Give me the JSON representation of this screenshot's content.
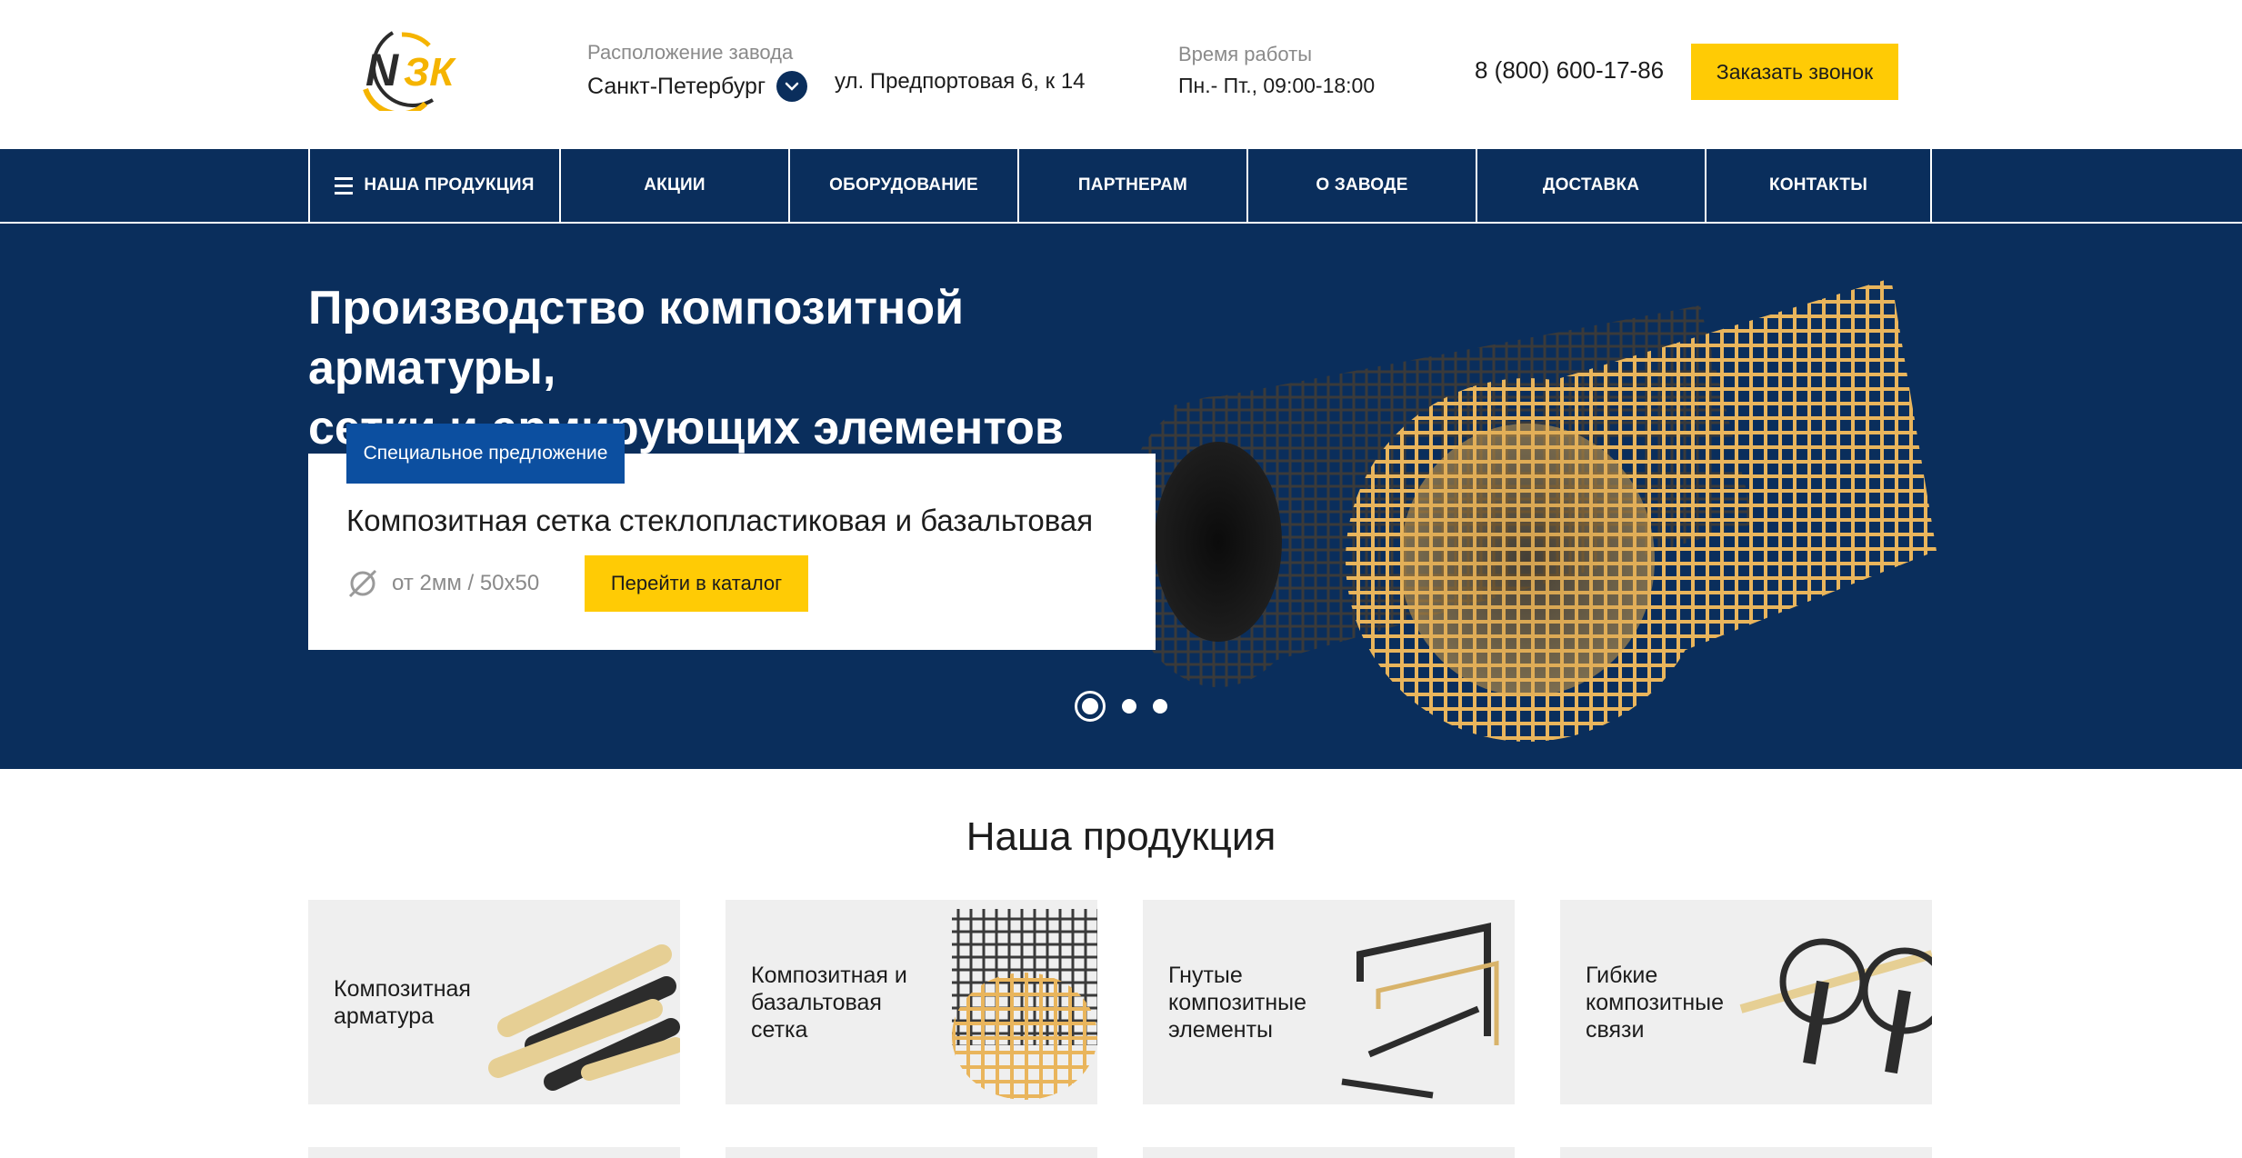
{
  "header": {
    "logo_text": "NЗК",
    "location_caption": "Расположение завода",
    "city": "Санкт-Петербург",
    "address": "ул. Предпортовая 6, к 14",
    "hours_caption": "Время работы",
    "hours": "Пн.- Пт., 09:00-18:00",
    "phone": "8 (800) 600-17-86",
    "call_button": "Заказать звонок"
  },
  "nav": {
    "items": [
      {
        "label": "НАША ПРОДУКЦИЯ"
      },
      {
        "label": "АКЦИИ"
      },
      {
        "label": "ОБОРУДОВАНИЕ"
      },
      {
        "label": "ПАРТНЕРАМ"
      },
      {
        "label": "О ЗАВОДЕ"
      },
      {
        "label": "ДОСТАВКА"
      },
      {
        "label": "КОНТАКТЫ"
      }
    ]
  },
  "hero": {
    "title_line1": "Производство композитной арматуры,",
    "title_line2": "сетки и армирующих элементов",
    "badge": "Специальное предложение",
    "offer_title": "Композитная сетка стеклопластиковая и базальтовая",
    "offer_spec": "от 2мм / 50х50",
    "catalog_button": "Перейти в каталог",
    "slides_total": 3,
    "active_slide": 1
  },
  "products": {
    "title": "Наша продукция",
    "items": [
      {
        "label": "Композитная арматура"
      },
      {
        "label": "Композитная и базальтовая сетка"
      },
      {
        "label": "Гнутые композитные элементы"
      },
      {
        "label": "Гибкие композитные связи"
      }
    ]
  },
  "colors": {
    "brand_navy": "#0a2e5c",
    "accent_yellow": "#ffcb05",
    "badge_blue": "#0c4fa0"
  }
}
